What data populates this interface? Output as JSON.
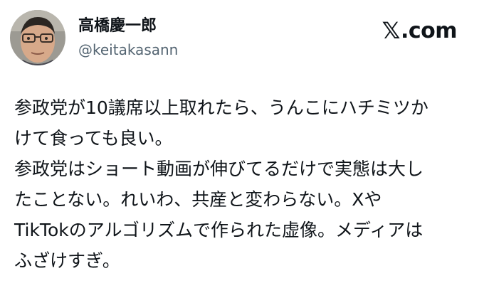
{
  "author": {
    "display_name": "高橋慶一郎",
    "handle": "@keitakasann"
  },
  "brand": {
    "logo_icon": "x-logo-icon",
    "logo_glyph": "𝕏",
    "domain": ".com"
  },
  "post": {
    "lines": [
      "参政党が10議席以上取れたら、うんこにハチミツか",
      "けて食っても良い。",
      "参政党はショート動画が伸びてるだけで実態は大し",
      "たことない。れいわ、共産と変わらない。Xや",
      "TikTokのアルゴリズムで作られた虚像。メディアは",
      "ふざけすぎ。"
    ]
  }
}
